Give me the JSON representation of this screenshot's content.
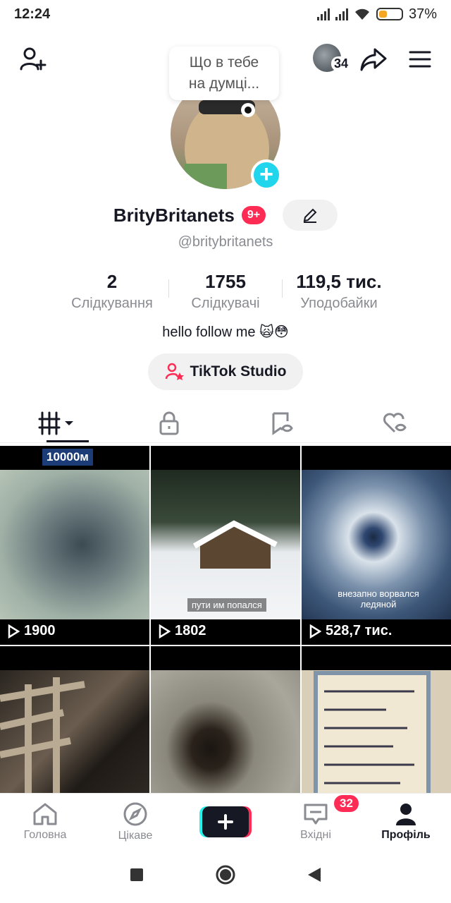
{
  "status_bar": {
    "time": "12:24",
    "battery": "37%",
    "battery_level": 0.37
  },
  "header": {
    "mini_avatar_count": "34"
  },
  "bubble": {
    "line1": "Що в тебе",
    "line2": "на думці..."
  },
  "profile": {
    "display_name": "BrityBritanets",
    "notification_badge": "9+",
    "handle": "@britybritanets",
    "bio": "hello follow me 🙀😳"
  },
  "stats": [
    {
      "value": "2",
      "label": "Слідкування"
    },
    {
      "value": "1755",
      "label": "Слідкувачі"
    },
    {
      "value": "119,5 тис.",
      "label": "Уподобайки"
    }
  ],
  "studio_button": {
    "label": "TikTok Studio"
  },
  "videos": [
    {
      "views": "1900",
      "overlay": "10000м"
    },
    {
      "views": "1802",
      "overlay": "пути им попался"
    },
    {
      "views": "528,7 тис.",
      "overlay": "внезапно ворвался ледяной"
    },
    {
      "views": ""
    },
    {
      "views": ""
    },
    {
      "views": ""
    }
  ],
  "bottom_nav": {
    "home": "Головна",
    "discover": "Цікаве",
    "inbox": "Вхідні",
    "inbox_badge": "32",
    "profile": "Профіль"
  },
  "colors": {
    "accent": "#fe2c55",
    "cyan": "#20d5ec",
    "text": "#161823",
    "muted": "#8a8b91"
  }
}
